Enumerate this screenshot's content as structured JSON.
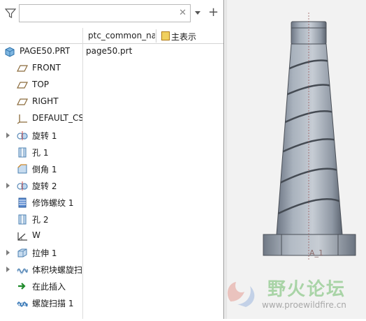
{
  "search": {
    "placeholder": "",
    "value": ""
  },
  "columns": {
    "name": "ptc_common_name",
    "main": "主表示"
  },
  "tree": [
    {
      "label": "PAGE50.PRT",
      "value": "page50.prt",
      "icon": "part-icon",
      "expandable": false,
      "indent": 0
    },
    {
      "label": "FRONT",
      "icon": "datum-plane-icon",
      "expandable": false,
      "indent": 1
    },
    {
      "label": "TOP",
      "icon": "datum-plane-icon",
      "expandable": false,
      "indent": 1
    },
    {
      "label": "RIGHT",
      "icon": "datum-plane-icon",
      "expandable": false,
      "indent": 1
    },
    {
      "label": "DEFAULT_CSYS",
      "icon": "csys-icon",
      "expandable": false,
      "indent": 1
    },
    {
      "label": "旋转 1",
      "icon": "revolve-icon",
      "expandable": true,
      "indent": 1
    },
    {
      "label": "孔 1",
      "icon": "hole-icon",
      "expandable": false,
      "indent": 1
    },
    {
      "label": "倒角 1",
      "icon": "chamfer-icon",
      "expandable": false,
      "indent": 1
    },
    {
      "label": "旋转 2",
      "icon": "revolve-icon",
      "expandable": true,
      "indent": 1
    },
    {
      "label": "修饰螺纹 1",
      "icon": "cosmetic-thread-icon",
      "expandable": false,
      "indent": 1
    },
    {
      "label": "孔 2",
      "icon": "hole-icon",
      "expandable": false,
      "indent": 1
    },
    {
      "label": "W",
      "icon": "angle-icon",
      "expandable": false,
      "indent": 1
    },
    {
      "label": "拉伸 1",
      "icon": "extrude-icon",
      "expandable": true,
      "indent": 1
    },
    {
      "label": "体积块螺旋扫描",
      "icon": "volume-helical-sweep-icon",
      "expandable": true,
      "indent": 1
    },
    {
      "label": "在此插入",
      "icon": "insert-here-arrow-icon",
      "expandable": false,
      "indent": 1
    },
    {
      "label": "螺旋扫描 1",
      "icon": "helical-sweep-icon",
      "expandable": false,
      "indent": 1
    }
  ],
  "viewport": {
    "datum_label": "A_1",
    "watermark_text": "野火论坛",
    "watermark_url": "www.proewildfire.cn"
  }
}
